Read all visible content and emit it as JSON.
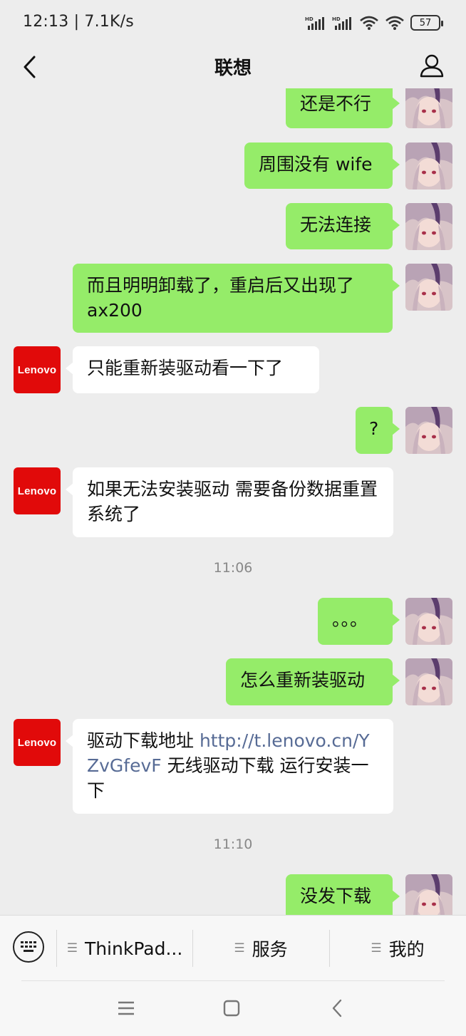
{
  "status": {
    "time": "12:13",
    "speed": "7.1K/s",
    "battery": "57"
  },
  "header": {
    "title": "联想"
  },
  "messages": [
    {
      "from": "me",
      "text": "还是不行"
    },
    {
      "from": "me",
      "text": "周围没有 wife"
    },
    {
      "from": "me",
      "text": "无法连接"
    },
    {
      "from": "me",
      "text": "而且明明卸载了，重启后又出现了ax200"
    },
    {
      "from": "lenovo",
      "text": "只能重新装驱动看一下了"
    },
    {
      "from": "me",
      "text": "?"
    },
    {
      "from": "lenovo",
      "text": "如果无法安装驱动 需要备份数据重置系统了"
    },
    {
      "from": "me",
      "text": "。。。"
    },
    {
      "from": "me",
      "text": "怎么重新装驱动"
    },
    {
      "from": "lenovo",
      "text_before": "驱动下载地址  ",
      "link": "http://t.lenovo.cn/YZvGfevF",
      "text_after": " 无线驱动下载   运行安装一下"
    },
    {
      "from": "me",
      "text": "没发下载"
    }
  ],
  "timestamps": [
    "11:06",
    "11:10"
  ],
  "avatar_label": "Lenovo",
  "menu": {
    "items": [
      "ThinkPad...",
      "服务",
      "我的"
    ]
  },
  "colors": {
    "my_bubble": "#95ec69",
    "their_bubble": "#ffffff",
    "background": "#ededed",
    "link": "#576b95",
    "lenovo_red": "#e10a0a"
  }
}
